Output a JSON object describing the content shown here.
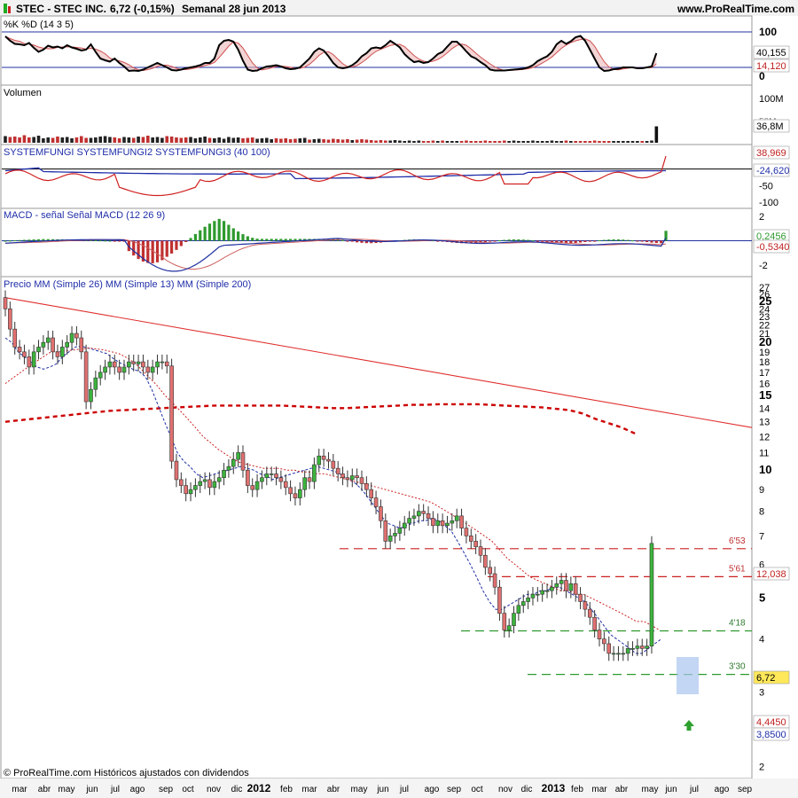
{
  "header": {
    "ticker_line": "STEC - STEC INC.",
    "price_change": "6,72 (-0,15%)",
    "period_date": "Semanal  28 jun 2013",
    "site": "www.ProRealTime.com"
  },
  "footer": {
    "copyright": "© ProRealTime.com  Históricos ajustados con dividendos"
  },
  "colors": {
    "up": "#22aa22",
    "down": "#cc2222",
    "sma26": "#cc2222",
    "sma13": "#1f2ea8",
    "sma200": "#cc0000",
    "trend": "#e03030"
  },
  "chart_data": [
    {
      "name_label": "%K %D (14 3 5)",
      "type": "line",
      "y_ticks": [
        "100",
        "50",
        "0"
      ],
      "badges": [
        "40,155",
        "14,120"
      ],
      "k_series": [
        90,
        80,
        73,
        72,
        70,
        75,
        64,
        55,
        60,
        69,
        65,
        67,
        63,
        70,
        65,
        62,
        58,
        60,
        72,
        55,
        40,
        36,
        33,
        40,
        30,
        22,
        12,
        13,
        12,
        15,
        20,
        25,
        30,
        25,
        20,
        14,
        13,
        15,
        18,
        20,
        22,
        25,
        30,
        30,
        40,
        70,
        80,
        82,
        78,
        60,
        35,
        15,
        12,
        13,
        18,
        22,
        23,
        25,
        22,
        18,
        16,
        17,
        20,
        30,
        40,
        55,
        63,
        58,
        45,
        30,
        20,
        18,
        20,
        25,
        33,
        45,
        52,
        63,
        65,
        63,
        70,
        80,
        73,
        65,
        50,
        40,
        32,
        34,
        30,
        32,
        40,
        50,
        55,
        67,
        78,
        78,
        68,
        56,
        45,
        40,
        32,
        25,
        15,
        13,
        13,
        13,
        14,
        15,
        16,
        17,
        20,
        25,
        34,
        40,
        45,
        55,
        72,
        80,
        73,
        79,
        88,
        91,
        80,
        60,
        40,
        20,
        12,
        13,
        16,
        17,
        20,
        20,
        20,
        18,
        18,
        20,
        22,
        52
      ]
    },
    {
      "name_label": "Volumen",
      "type": "bar",
      "y_ticks": [
        "100M",
        "50M"
      ],
      "badges": [
        "36,8M"
      ],
      "values": [
        15,
        13,
        14,
        12,
        17,
        12,
        13,
        16,
        10,
        12,
        11,
        14,
        12,
        13,
        10,
        12,
        15,
        11,
        11,
        12,
        14,
        15,
        13,
        12,
        10,
        13,
        12,
        11,
        14,
        13,
        16,
        12,
        13,
        11,
        15,
        14,
        12,
        11,
        12,
        13,
        10,
        12,
        14,
        11,
        10,
        12,
        9,
        13,
        11,
        12,
        10,
        11,
        12,
        9,
        10,
        11,
        8,
        10,
        9,
        10,
        8,
        9,
        10,
        11,
        7,
        8,
        9,
        8,
        7,
        9,
        8,
        7,
        8,
        6,
        7,
        8,
        7,
        6,
        5,
        6,
        5,
        5,
        6,
        5,
        4,
        5,
        4,
        5,
        4,
        4,
        5,
        4,
        5,
        4,
        4,
        4,
        4,
        5,
        4,
        4,
        4,
        5,
        4,
        4,
        4,
        5,
        4,
        5,
        4,
        4,
        4,
        5,
        4,
        4,
        4,
        5,
        4,
        4,
        5,
        4,
        4,
        4,
        4,
        4,
        5,
        4,
        4,
        4,
        4,
        4,
        4,
        4,
        4,
        4,
        4,
        4,
        5,
        37
      ]
    },
    {
      "name_label": "SYSTEMFUNGI  SYSTEMFUNGI2  SYSTEMFUNGI3 (40 100)",
      "type": "line",
      "y_ticks": [
        "50",
        "0",
        "-50",
        "-100"
      ],
      "badges": [
        "38,969",
        "-24,620"
      ]
    },
    {
      "name_label": "MACD - señal  Señal MACD (12 26 9)",
      "type": "bar",
      "y_ticks": [
        "2",
        "0",
        "-2"
      ],
      "badges": [
        "0,2456",
        "-0,5340"
      ]
    },
    {
      "name_label": "Precio  MM (Simple 26)  MM (Simple 13)  MM (Simple 200)",
      "type": "line",
      "y_ticks": [
        "27",
        "26",
        "25",
        "24",
        "23",
        "22",
        "21",
        "20",
        "19",
        "18",
        "17",
        "16",
        "15",
        "14",
        "13",
        "12",
        "11",
        "10",
        "9",
        "8",
        "7",
        "6",
        "5",
        "4",
        "3",
        "2"
      ],
      "badges": [
        "12,038",
        "6,72",
        "4,4450",
        "3,8500"
      ],
      "level_labels": [
        "6'53",
        "5'61",
        "4'18",
        "3'30"
      ],
      "closes": [
        24,
        21.5,
        19.5,
        19,
        18.5,
        17.5,
        19,
        19.5,
        20,
        20.5,
        19,
        18.5,
        19.5,
        20,
        21,
        20.5,
        19,
        14.5,
        15.5,
        16.5,
        17,
        17.5,
        18,
        17.5,
        17,
        17.5,
        18,
        17.8,
        18,
        17.5,
        17,
        17.5,
        18,
        18,
        17.6,
        10.5,
        9.5,
        9.2,
        8.8,
        9,
        9.2,
        9.4,
        9.5,
        9.1,
        9.4,
        9.6,
        10,
        10.2,
        10.6,
        11,
        10,
        9.2,
        9,
        9.4,
        9.6,
        9.8,
        9.8,
        9.6,
        9.4,
        9.1,
        8.8,
        8.6,
        9,
        9.6,
        9.4,
        10.3,
        10.8,
        10.6,
        10.5,
        10.1,
        9.8,
        9.6,
        9.5,
        9.7,
        9.6,
        9.3,
        9,
        8.6,
        8.2,
        7.6,
        6.8,
        7,
        7.1,
        7.3,
        7.5,
        7.7,
        7.8,
        8,
        7.9,
        7.7,
        7.4,
        7.6,
        7.4,
        7.5,
        7.6,
        7.8,
        7.3,
        7,
        6.8,
        6.6,
        6.3,
        5.9,
        5.7,
        5.3,
        4.6,
        4.2,
        4.3,
        4.6,
        4.8,
        4.9,
        5,
        5.1,
        5.1,
        5.2,
        5.2,
        5.3,
        5.4,
        5.5,
        5.2,
        5.4,
        5.1,
        4.9,
        4.7,
        4.5,
        4.2,
        4,
        3.9,
        3.7,
        3.7,
        3.7,
        3.7,
        3.8,
        3.8,
        3.85,
        3.8,
        3.85,
        6.72
      ],
      "sma200": [
        13,
        13.1,
        13.2,
        13.3,
        13.4,
        13.5,
        13.6,
        13.7,
        13.8,
        13.85,
        13.9,
        13.95,
        14,
        14.05,
        14.1,
        14.15,
        14.2,
        14.2,
        14.2,
        14.2,
        14.2,
        14.2,
        14.15,
        14.1,
        14.05,
        14,
        14,
        14.05,
        14.1,
        14.15,
        14.2,
        14.25,
        14.25,
        14.3,
        14.3,
        14.3,
        14.3,
        14.25,
        14.2,
        14.15,
        14.1,
        14.05,
        13.95,
        13.85,
        13.6,
        13.2,
        12.9,
        12.6,
        12.2
      ],
      "sma13": [
        20.5,
        20,
        19,
        18.5,
        18,
        17.5,
        17.3,
        17.5,
        17.8,
        18.5,
        19,
        19.5,
        19.6,
        19.4,
        19.2,
        19,
        18.8,
        18.3,
        17.9,
        17.6,
        17.3,
        17.1,
        16.6,
        15.5,
        14.2,
        13,
        12,
        11,
        10.5,
        10.2,
        9.8,
        9.6,
        9.7,
        9.8,
        9.9,
        10,
        10.1,
        10.2,
        10.1,
        10,
        9.8,
        9.7,
        9.5,
        9.6,
        9.7,
        9.8,
        9.9,
        10,
        10.1,
        10.2,
        10.1,
        10,
        9.9,
        9.7,
        9.5,
        9.3,
        9,
        8.6,
        8.2,
        7.8,
        7.5,
        7.4,
        7.3,
        7.4,
        7.5,
        7.6,
        7.6,
        7.7,
        7.6,
        7.4,
        7.2,
        6.8,
        6.4,
        6,
        5.6,
        5.2,
        4.9,
        4.7,
        4.7,
        4.8,
        4.9,
        5,
        5.1,
        5.1,
        5.2,
        5.2,
        5.3,
        5.3,
        5.2,
        5.1,
        5,
        4.9,
        4.7,
        4.5,
        4.3,
        4.1,
        4,
        3.9,
        3.8,
        3.7,
        3.7,
        3.8,
        3.9,
        4
      ],
      "sma26": [
        16,
        16.5,
        17,
        17.5,
        18,
        18.5,
        19,
        19,
        19.1,
        19.2,
        19.3,
        19.4,
        19.3,
        19.2,
        19,
        18.8,
        18.4,
        17.9,
        17.2,
        16.5,
        15.8,
        15,
        14.4,
        13.8,
        13.2,
        12.6,
        12,
        11.6,
        11.2,
        10.9,
        10.6,
        10.4,
        10.3,
        10.2,
        10.1,
        10.1,
        10.1,
        10,
        10,
        9.9,
        9.9,
        9.8,
        9.8,
        9.7,
        9.6,
        9.5,
        9.4,
        9.3,
        9.2,
        9.1,
        9,
        8.9,
        8.8,
        8.7,
        8.6,
        8.5,
        8.4,
        8.2,
        8,
        7.8,
        7.6,
        7.4,
        7.2,
        7,
        6.8,
        6.5,
        6.2,
        6,
        5.8,
        5.6,
        5.5,
        5.4,
        5.3,
        5.2,
        5.2,
        5.1,
        5.1,
        5,
        4.9,
        4.8,
        4.7,
        4.6,
        4.5,
        4.4,
        4.4,
        4.3,
        4.2
      ]
    }
  ],
  "x_axis": {
    "labels": [
      "mar",
      "abr",
      "may",
      "jun",
      "jul",
      "ago",
      "sep",
      "oct",
      "nov",
      "dic",
      "2012",
      "feb",
      "mar",
      "abr",
      "may",
      "jun",
      "jul",
      "ago",
      "sep",
      "oct",
      "nov",
      "dic",
      "2013",
      "feb",
      "mar",
      "abr",
      "may",
      "jun",
      "jul",
      "ago",
      "sep"
    ],
    "bold": [
      10,
      22
    ]
  }
}
